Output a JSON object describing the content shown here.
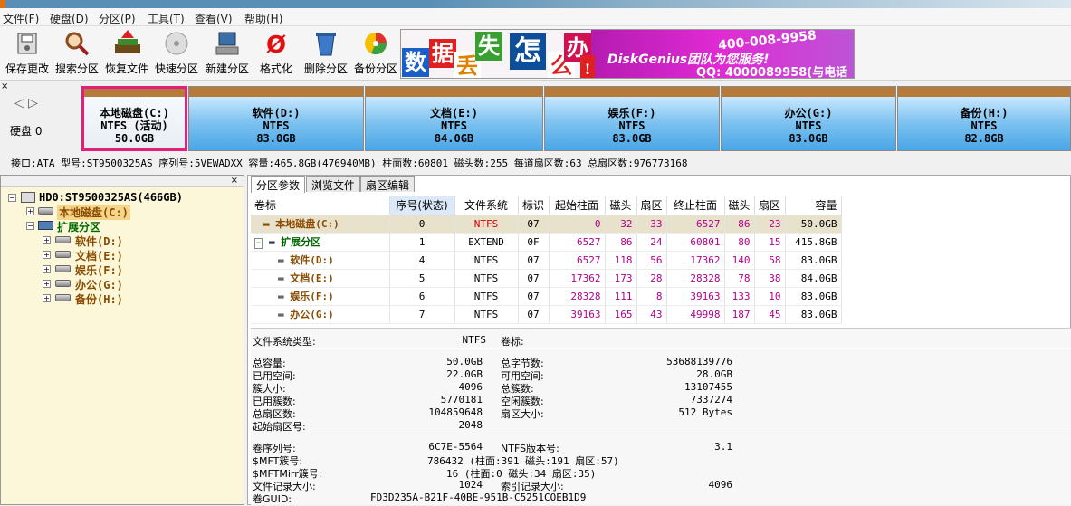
{
  "menu": [
    "文件(F)",
    "硬盘(D)",
    "分区(P)",
    "工具(T)",
    "查看(V)",
    "帮助(H)"
  ],
  "toolbar": [
    {
      "label": "保存更改",
      "icon": "save-icon"
    },
    {
      "label": "搜索分区",
      "icon": "search-icon"
    },
    {
      "label": "恢复文件",
      "icon": "recover-icon"
    },
    {
      "label": "快速分区",
      "icon": "quick-partition-icon"
    },
    {
      "label": "新建分区",
      "icon": "new-partition-icon"
    },
    {
      "label": "格式化",
      "icon": "format-icon"
    },
    {
      "label": "删除分区",
      "icon": "delete-icon"
    },
    {
      "label": "备份分区",
      "icon": "backup-icon"
    }
  ],
  "banner": {
    "chars": [
      "数",
      "据",
      "丢",
      "失",
      "怎",
      "么",
      "办",
      "!"
    ],
    "brand": "DiskGenius团队为您服务!",
    "phone": "400-008-9958",
    "qq": "QQ: 4000089958(与电话同号)"
  },
  "disk_label": "硬盘 0",
  "partitions": [
    {
      "name": "本地磁盘(C:)",
      "fs": "NTFS (活动)",
      "size": "50.0GB"
    },
    {
      "name": "软件(D:)",
      "fs": "NTFS",
      "size": "83.0GB"
    },
    {
      "name": "文档(E:)",
      "fs": "NTFS",
      "size": "84.0GB"
    },
    {
      "name": "娱乐(F:)",
      "fs": "NTFS",
      "size": "83.0GB"
    },
    {
      "name": "办公(G:)",
      "fs": "NTFS",
      "size": "83.0GB"
    },
    {
      "name": "备份(H:)",
      "fs": "NTFS",
      "size": "82.8GB"
    }
  ],
  "disk_info": "接口:ATA  型号:ST9500325AS  序列号:5VEWADXX  容量:465.8GB(476940MB)  柱面数:60801  磁头数:255  每道扇区数:63  总扇区数:976773168",
  "tree": {
    "root": "HD0:ST9500325AS(466GB)",
    "c": "本地磁盘(C:)",
    "ext": "扩展分区",
    "children": [
      "软件(D:)",
      "文档(E:)",
      "娱乐(F:)",
      "办公(G:)",
      "备份(H:)"
    ]
  },
  "tabs": [
    "分区参数",
    "浏览文件",
    "扇区编辑"
  ],
  "table": {
    "headers": [
      "卷标",
      "序号(状态)",
      "文件系统",
      "标识",
      "起始柱面",
      "磁头",
      "扇区",
      "终止柱面",
      "磁头",
      "扇区",
      "容量"
    ],
    "rows": [
      [
        "本地磁盘(C:)",
        "0",
        "NTFS",
        "07",
        "0",
        "32",
        "33",
        "6527",
        "86",
        "23",
        "50.0GB"
      ],
      [
        "扩展分区",
        "1",
        "EXTEND",
        "0F",
        "6527",
        "86",
        "24",
        "60801",
        "80",
        "15",
        "415.8GB"
      ],
      [
        "软件(D:)",
        "4",
        "NTFS",
        "07",
        "6527",
        "118",
        "56",
        "17362",
        "140",
        "58",
        "83.0GB"
      ],
      [
        "文档(E:)",
        "5",
        "NTFS",
        "07",
        "17362",
        "173",
        "28",
        "28328",
        "78",
        "38",
        "84.0GB"
      ],
      [
        "娱乐(F:)",
        "6",
        "NTFS",
        "07",
        "28328",
        "111",
        "8",
        "39163",
        "133",
        "10",
        "83.0GB"
      ],
      [
        "办公(G:)",
        "7",
        "NTFS",
        "07",
        "39163",
        "165",
        "43",
        "49998",
        "187",
        "45",
        "83.0GB"
      ]
    ]
  },
  "details": {
    "fs_type_label": "文件系统类型:",
    "fs_type": "NTFS",
    "vol_label_label": "卷标:",
    "left": [
      [
        "总容量:",
        "50.0GB"
      ],
      [
        "已用空间:",
        "22.0GB"
      ],
      [
        "簇大小:",
        "4096"
      ],
      [
        "已用簇数:",
        "5770181"
      ],
      [
        "总扇区数:",
        "104859648"
      ],
      [
        "起始扇区号:",
        "2048"
      ]
    ],
    "right": [
      [
        "总字节数:",
        "53688139776"
      ],
      [
        "可用空间:",
        "28.0GB"
      ],
      [
        "总簇数:",
        "13107455"
      ],
      [
        "空闲簇数:",
        "7337274"
      ],
      [
        "扇区大小:",
        "512 Bytes"
      ]
    ],
    "serial_label": "卷序列号:",
    "serial": "6C7E-5564",
    "ntfs_ver_label": "NTFS版本号:",
    "ntfs_ver": "3.1",
    "mft_label": "$MFT簇号:",
    "mft": "786432 (柱面:391 磁头:191 扇区:57)",
    "mftmirr_label": "$MFTMirr簇号:",
    "mftmirr": "16 (柱面:0 磁头:34 扇区:35)",
    "rec_label": "文件记录大小:",
    "rec": "1024",
    "idx_label": "索引记录大小:",
    "idx": "4096",
    "guid_label": "卷GUID:",
    "guid": "FD3D235A-B21F-40BE-951B-C5251COEB1D9"
  }
}
